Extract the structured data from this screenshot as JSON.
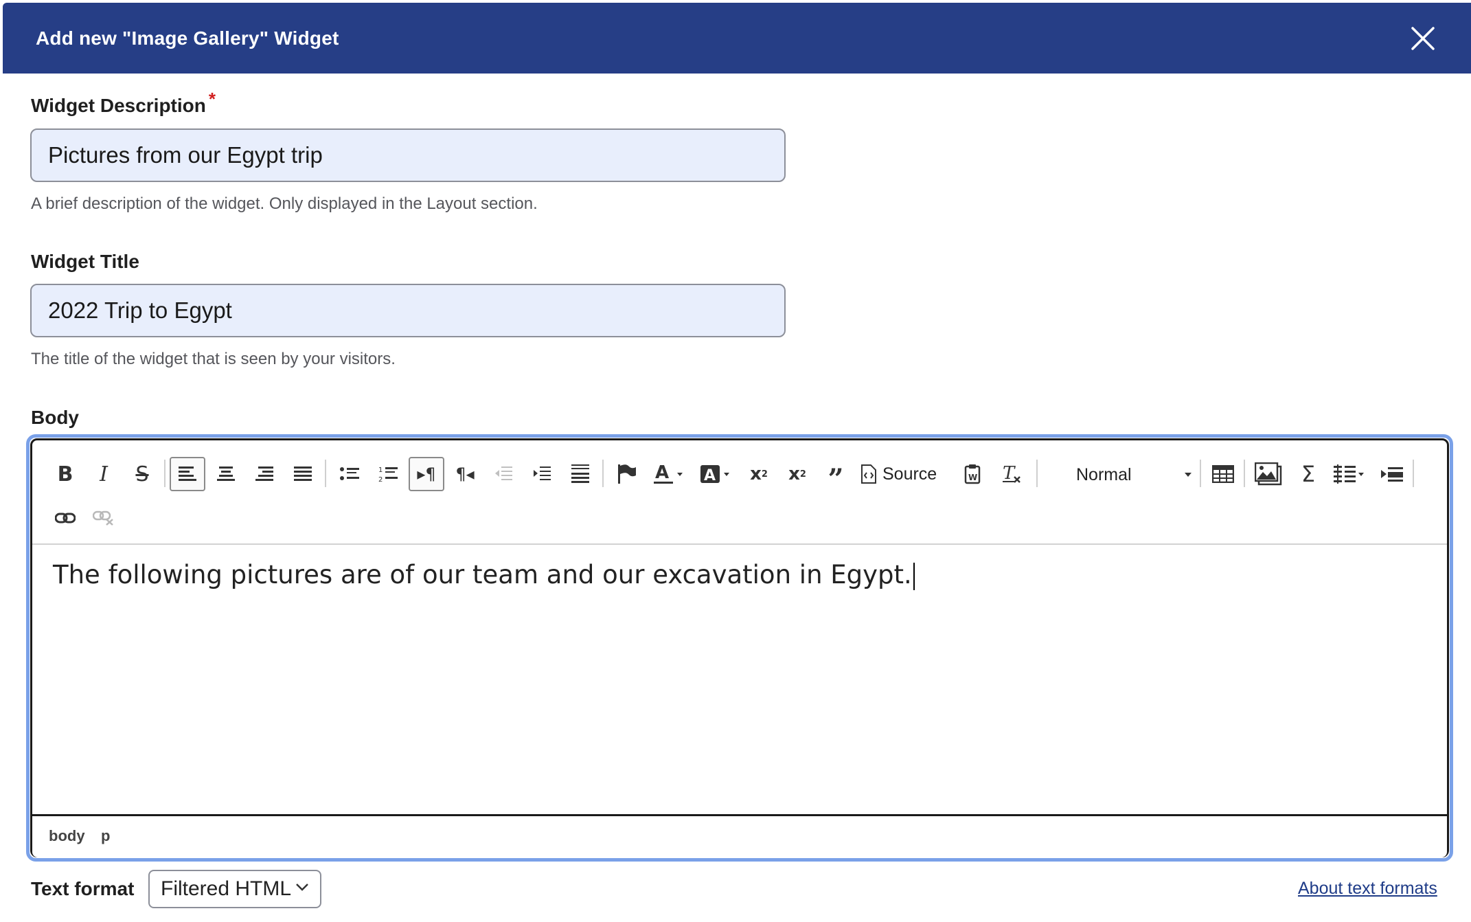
{
  "dialog": {
    "title": "Add new \"Image Gallery\" Widget",
    "close_icon": "close-icon"
  },
  "description_field": {
    "label": "Widget Description",
    "required_mark": "*",
    "value": "Pictures from our Egypt trip",
    "help": "A brief description of the widget. Only displayed in the Layout section."
  },
  "title_field": {
    "label": "Widget Title",
    "value": "2022 Trip to Egypt",
    "help": "The title of the widget that is seen by your visitors."
  },
  "body": {
    "label": "Body",
    "toolbar": {
      "source_label": "Source",
      "format_value": "Normal",
      "icons": [
        "bold-icon",
        "italic-icon",
        "strikethrough-icon",
        "align-left-icon",
        "align-center-icon",
        "align-right-icon",
        "align-justify-icon",
        "bulleted-list-icon",
        "numbered-list-icon",
        "ltr-icon",
        "rtl-icon",
        "outdent-icon",
        "indent-icon",
        "blocks-icon",
        "anchor-icon",
        "text-color-icon",
        "background-color-icon",
        "superscript-icon",
        "subscript-icon",
        "blockquote-icon",
        "source-icon",
        "paste-word-icon",
        "remove-format-icon",
        "table-icon",
        "image-icon",
        "math-icon",
        "template-icon",
        "insert-paragraph-icon",
        "link-icon",
        "unlink-icon"
      ]
    },
    "content": "The following pictures are of our team and our excavation in Egypt.",
    "path": [
      "body",
      "p"
    ]
  },
  "text_format": {
    "label": "Text format",
    "value": "Filtered HTML",
    "about_link": "About text formats"
  },
  "colors": {
    "header_bg": "#263e86",
    "field_bg": "#e8eefc",
    "focus_ring": "#7aa1e8",
    "required": "#d12020",
    "link": "#1f3c88"
  }
}
